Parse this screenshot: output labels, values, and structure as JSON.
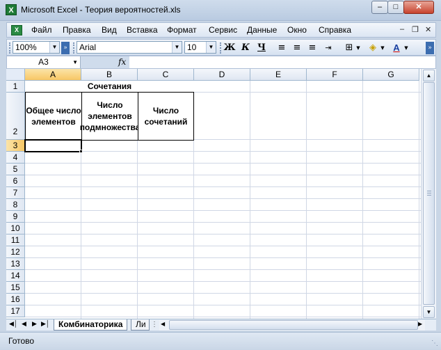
{
  "window": {
    "title": "Microsoft Excel - Теория вероятностей.xls",
    "app_icon_letter": "X"
  },
  "menu": {
    "items": [
      {
        "label": "Файл"
      },
      {
        "label": "Правка"
      },
      {
        "label": "Вид"
      },
      {
        "label": "Вставка"
      },
      {
        "label": "Формат"
      },
      {
        "label": "Сервис"
      },
      {
        "label": "Данные"
      },
      {
        "label": "Окно"
      },
      {
        "label": "Справка"
      }
    ]
  },
  "toolbar": {
    "zoom": "100%",
    "font": "Arial",
    "font_size": "10",
    "bold": "Ж",
    "italic": "К",
    "underline": "Ч"
  },
  "formula_bar": {
    "name_box": "A3",
    "fx": "fx",
    "content": ""
  },
  "columns": [
    "A",
    "B",
    "C",
    "D",
    "E",
    "F",
    "G"
  ],
  "rows": [
    "1",
    "2",
    "3",
    "4",
    "5",
    "6",
    "7",
    "8",
    "9",
    "10",
    "11",
    "12",
    "13",
    "14",
    "15",
    "16",
    "17"
  ],
  "cells": {
    "A1": "Сочетания",
    "A2": "Общее число элементов",
    "B2": "Число элементов подмножества",
    "C2": "Число сочетаний"
  },
  "selection": {
    "column": "A",
    "row": "3"
  },
  "sheet_tabs": [
    {
      "label": "Комбинаторика",
      "active": true
    },
    {
      "label": "Ли",
      "active": false
    }
  ],
  "status": {
    "text": "Готово"
  },
  "colors": {
    "selection_header": "#f8c765",
    "grid": "#d0d7e5",
    "chrome": "#c9d6e6"
  }
}
